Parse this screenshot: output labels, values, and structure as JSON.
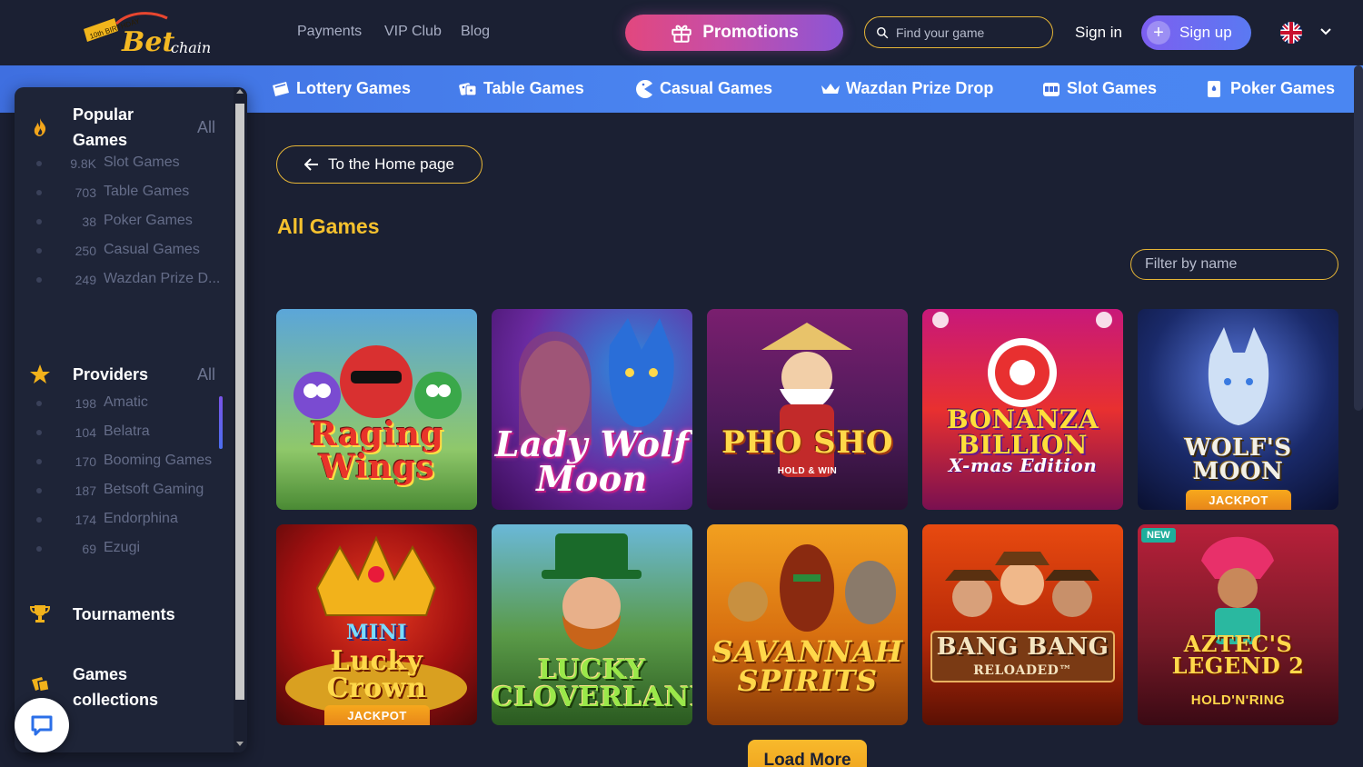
{
  "header": {
    "nav": [
      "Payments",
      "VIP Club",
      "Blog"
    ],
    "promotions_label": "Promotions",
    "search_placeholder": "Find your game",
    "signin_label": "Sign in",
    "signup_label": "Sign up",
    "logo_text": "Betchain",
    "logo_badge": "10th BIRTHDAY"
  },
  "categories": [
    {
      "label": "Lottery Games",
      "icon": "lottery-ticket-icon"
    },
    {
      "label": "Table Games",
      "icon": "dice-icon"
    },
    {
      "label": "Casual Games",
      "icon": "pacman-icon"
    },
    {
      "label": "Wazdan Prize Drop",
      "icon": "crown-icon"
    },
    {
      "label": "Slot Games",
      "icon": "slot-machine-icon"
    },
    {
      "label": "Poker Games",
      "icon": "poker-icon"
    }
  ],
  "sidebar": {
    "popular": {
      "title": "Popular Games",
      "all_label": "All",
      "items": [
        {
          "count": "9.8K",
          "label": "Slot Games"
        },
        {
          "count": "703",
          "label": "Table Games"
        },
        {
          "count": "38",
          "label": "Poker Games"
        },
        {
          "count": "250",
          "label": "Casual Games"
        },
        {
          "count": "249",
          "label": "Wazdan Prize D..."
        }
      ]
    },
    "providers": {
      "title": "Providers",
      "all_label": "All",
      "items": [
        {
          "count": "198",
          "label": "Amatic"
        },
        {
          "count": "104",
          "label": "Belatra"
        },
        {
          "count": "170",
          "label": "Booming Games"
        },
        {
          "count": "187",
          "label": "Betsoft Gaming"
        },
        {
          "count": "174",
          "label": "Endorphina"
        },
        {
          "count": "69",
          "label": "Ezugi"
        }
      ]
    },
    "tournaments_label": "Tournaments",
    "collections_label": "Games collections"
  },
  "main": {
    "home_button": "To the Home page",
    "title": "All Games",
    "filter_placeholder": "Filter by name",
    "load_more": "Load More"
  },
  "games": [
    {
      "title": "Raging Wings",
      "jackpot": "",
      "badge": ""
    },
    {
      "title": "Lady Wolf Moon",
      "jackpot": "",
      "badge": ""
    },
    {
      "title": "PHO SHO",
      "subtitle": "HOLD & WIN",
      "jackpot": "",
      "badge": ""
    },
    {
      "title": "BONANZA BILLION",
      "subtitle": "X-mas Edition",
      "jackpot": "",
      "badge": ""
    },
    {
      "title": "WOLF'S MOON",
      "jackpot": "JACKPOT",
      "badge": ""
    },
    {
      "title": "Lucky Crown",
      "subtitle": "MINI",
      "jackpot": "JACKPOT",
      "badge": ""
    },
    {
      "title": "LUCKY CLOVERLAND",
      "jackpot": "",
      "badge": ""
    },
    {
      "title": "SAVANNAH SPIRITS",
      "jackpot": "",
      "badge": ""
    },
    {
      "title": "BANG BANG",
      "subtitle": "RELOADED™",
      "jackpot": "",
      "badge": ""
    },
    {
      "title": "AZTEC'S LEGEND 2",
      "subtitle": "HOLD'N'RING",
      "jackpot": "",
      "badge": "NEW"
    }
  ],
  "colors": {
    "background": "#1b2033",
    "accent_gold": "#e7b636",
    "category_bar": "#4a84f0",
    "title_gold": "#f5c12e"
  }
}
